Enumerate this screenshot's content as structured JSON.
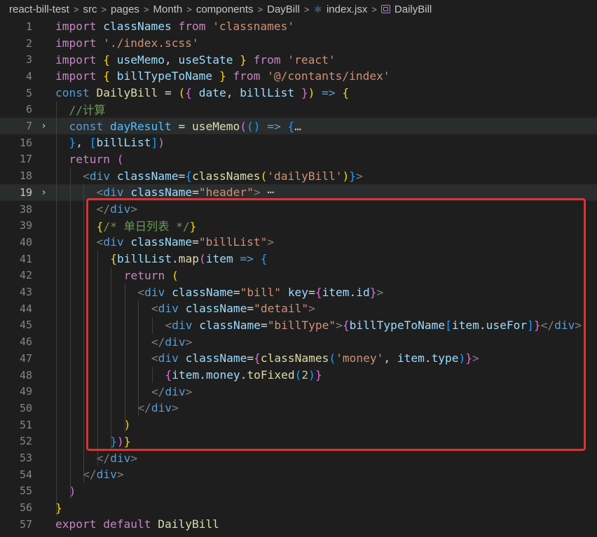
{
  "breadcrumb": {
    "items": [
      "react-bill-test",
      "src",
      "pages",
      "Month",
      "components",
      "DayBill",
      "index.jsx",
      "DailyBill"
    ],
    "separator": ">",
    "icons": {
      "index.jsx": "react-icon",
      "DailyBill": "component-icon"
    }
  },
  "editor": {
    "active_line": "19",
    "lines": [
      {
        "n": "1",
        "tokens": [
          [
            "imp",
            "import"
          ],
          [
            "pun",
            " "
          ],
          [
            "var",
            "classNames"
          ],
          [
            "pun",
            " "
          ],
          [
            "imp",
            "from"
          ],
          [
            "pun",
            " "
          ],
          [
            "str",
            "'classnames'"
          ]
        ]
      },
      {
        "n": "2",
        "tokens": [
          [
            "imp",
            "import"
          ],
          [
            "pun",
            " "
          ],
          [
            "str",
            "'./index.scss'"
          ]
        ]
      },
      {
        "n": "3",
        "tokens": [
          [
            "imp",
            "import"
          ],
          [
            "pun",
            " "
          ],
          [
            "b1",
            "{"
          ],
          [
            "pun",
            " "
          ],
          [
            "var",
            "useMemo"
          ],
          [
            "pun",
            ", "
          ],
          [
            "var",
            "useState"
          ],
          [
            "pun",
            " "
          ],
          [
            "b1",
            "}"
          ],
          [
            "pun",
            " "
          ],
          [
            "imp",
            "from"
          ],
          [
            "pun",
            " "
          ],
          [
            "str",
            "'react'"
          ]
        ]
      },
      {
        "n": "4",
        "tokens": [
          [
            "imp",
            "import"
          ],
          [
            "pun",
            " "
          ],
          [
            "b1",
            "{"
          ],
          [
            "pun",
            " "
          ],
          [
            "var",
            "billTypeToName"
          ],
          [
            "pun",
            " "
          ],
          [
            "b1",
            "}"
          ],
          [
            "pun",
            " "
          ],
          [
            "imp",
            "from"
          ],
          [
            "pun",
            " "
          ],
          [
            "str",
            "'@/contants/index'"
          ]
        ]
      },
      {
        "n": "5",
        "tokens": [
          [
            "kw",
            "const"
          ],
          [
            "pun",
            " "
          ],
          [
            "fn",
            "DailyBill"
          ],
          [
            "pun",
            " = "
          ],
          [
            "b1",
            "("
          ],
          [
            "b2",
            "{"
          ],
          [
            "pun",
            " "
          ],
          [
            "var",
            "date"
          ],
          [
            "pun",
            ", "
          ],
          [
            "var",
            "billList"
          ],
          [
            "pun",
            " "
          ],
          [
            "b2",
            "}"
          ],
          [
            "b1",
            ")"
          ],
          [
            "pun",
            " "
          ],
          [
            "kw",
            "=>"
          ],
          [
            "pun",
            " "
          ],
          [
            "b1",
            "{"
          ]
        ]
      },
      {
        "n": "6",
        "tokens": [
          [
            "com",
            "//计算"
          ]
        ]
      },
      {
        "n": "7",
        "fold": "›",
        "highlight": true,
        "tokens": [
          [
            "kw",
            "const"
          ],
          [
            "pun",
            " "
          ],
          [
            "const",
            "dayResult"
          ],
          [
            "pun",
            " = "
          ],
          [
            "fn",
            "useMemo"
          ],
          [
            "b2",
            "("
          ],
          [
            "b3",
            "("
          ],
          [
            "b3",
            ")"
          ],
          [
            "pun",
            " "
          ],
          [
            "kw",
            "=>"
          ],
          [
            "pun",
            " "
          ],
          [
            "b3",
            "{"
          ],
          [
            "ell",
            "…"
          ]
        ]
      },
      {
        "n": "16",
        "tokens": [
          [
            "b3",
            "}"
          ],
          [
            "pun",
            ", "
          ],
          [
            "b3",
            "["
          ],
          [
            "var",
            "billList"
          ],
          [
            "b3",
            "]"
          ],
          [
            "b2",
            ")"
          ]
        ]
      },
      {
        "n": "17",
        "tokens": [
          [
            "imp",
            "return"
          ],
          [
            "pun",
            " "
          ],
          [
            "b2",
            "("
          ]
        ]
      },
      {
        "n": "18",
        "tokens": [
          [
            "gray",
            "<"
          ],
          [
            "tag",
            "div"
          ],
          [
            "pun",
            " "
          ],
          [
            "attr",
            "className"
          ],
          [
            "pun",
            "="
          ],
          [
            "b3",
            "{"
          ],
          [
            "fn",
            "classNames"
          ],
          [
            "b1",
            "("
          ],
          [
            "str",
            "'dailyBill'"
          ],
          [
            "b1",
            ")"
          ],
          [
            "b3",
            "}"
          ],
          [
            "gray",
            ">"
          ]
        ]
      },
      {
        "n": "19",
        "fold": "›",
        "highlight": true,
        "tokens": [
          [
            "gray",
            "<"
          ],
          [
            "tag",
            "div"
          ],
          [
            "pun",
            " "
          ],
          [
            "attr",
            "className"
          ],
          [
            "pun",
            "="
          ],
          [
            "str",
            "\"header\""
          ],
          [
            "gray",
            ">"
          ],
          [
            "ell",
            " ⋯"
          ]
        ]
      },
      {
        "n": "38",
        "tokens": [
          [
            "gray",
            "</"
          ],
          [
            "tag",
            "div"
          ],
          [
            "gray",
            ">"
          ]
        ]
      },
      {
        "n": "39",
        "tokens": [
          [
            "b1",
            "{"
          ],
          [
            "com",
            "/* 单日列表 */"
          ],
          [
            "b1",
            "}"
          ]
        ]
      },
      {
        "n": "40",
        "tokens": [
          [
            "gray",
            "<"
          ],
          [
            "tag",
            "div"
          ],
          [
            "pun",
            " "
          ],
          [
            "attr",
            "className"
          ],
          [
            "pun",
            "="
          ],
          [
            "str",
            "\"billList\""
          ],
          [
            "gray",
            ">"
          ]
        ]
      },
      {
        "n": "41",
        "tokens": [
          [
            "b1",
            "{"
          ],
          [
            "var",
            "billList"
          ],
          [
            "pun",
            "."
          ],
          [
            "fn",
            "map"
          ],
          [
            "b2",
            "("
          ],
          [
            "var",
            "item"
          ],
          [
            "pun",
            " "
          ],
          [
            "kw",
            "=>"
          ],
          [
            "pun",
            " "
          ],
          [
            "b3",
            "{"
          ]
        ]
      },
      {
        "n": "42",
        "tokens": [
          [
            "imp",
            "return"
          ],
          [
            "pun",
            " "
          ],
          [
            "b1",
            "("
          ]
        ]
      },
      {
        "n": "43",
        "tokens": [
          [
            "gray",
            "<"
          ],
          [
            "tag",
            "div"
          ],
          [
            "pun",
            " "
          ],
          [
            "attr",
            "className"
          ],
          [
            "pun",
            "="
          ],
          [
            "str",
            "\"bill\""
          ],
          [
            "pun",
            " "
          ],
          [
            "attr",
            "key"
          ],
          [
            "pun",
            "="
          ],
          [
            "b2",
            "{"
          ],
          [
            "var",
            "item"
          ],
          [
            "pun",
            "."
          ],
          [
            "var",
            "id"
          ],
          [
            "b2",
            "}"
          ],
          [
            "gray",
            ">"
          ]
        ]
      },
      {
        "n": "44",
        "tokens": [
          [
            "gray",
            "<"
          ],
          [
            "tag",
            "div"
          ],
          [
            "pun",
            " "
          ],
          [
            "attr",
            "className"
          ],
          [
            "pun",
            "="
          ],
          [
            "str",
            "\"detail\""
          ],
          [
            "gray",
            ">"
          ]
        ]
      },
      {
        "n": "45",
        "tokens": [
          [
            "gray",
            "<"
          ],
          [
            "tag",
            "div"
          ],
          [
            "pun",
            " "
          ],
          [
            "attr",
            "className"
          ],
          [
            "pun",
            "="
          ],
          [
            "str",
            "\"billType\""
          ],
          [
            "gray",
            ">"
          ],
          [
            "b2",
            "{"
          ],
          [
            "var",
            "billTypeToName"
          ],
          [
            "b3",
            "["
          ],
          [
            "var",
            "item"
          ],
          [
            "pun",
            "."
          ],
          [
            "var",
            "useFor"
          ],
          [
            "b3",
            "]"
          ],
          [
            "b2",
            "}"
          ],
          [
            "gray",
            "</"
          ],
          [
            "tag",
            "div"
          ],
          [
            "gray",
            ">"
          ]
        ]
      },
      {
        "n": "46",
        "tokens": [
          [
            "gray",
            "</"
          ],
          [
            "tag",
            "div"
          ],
          [
            "gray",
            ">"
          ]
        ]
      },
      {
        "n": "47",
        "tokens": [
          [
            "gray",
            "<"
          ],
          [
            "tag",
            "div"
          ],
          [
            "pun",
            " "
          ],
          [
            "attr",
            "className"
          ],
          [
            "pun",
            "="
          ],
          [
            "b2",
            "{"
          ],
          [
            "fn",
            "classNames"
          ],
          [
            "b3",
            "("
          ],
          [
            "str",
            "'money'"
          ],
          [
            "pun",
            ", "
          ],
          [
            "var",
            "item"
          ],
          [
            "pun",
            "."
          ],
          [
            "var",
            "type"
          ],
          [
            "b3",
            ")"
          ],
          [
            "b2",
            "}"
          ],
          [
            "gray",
            ">"
          ]
        ]
      },
      {
        "n": "48",
        "tokens": [
          [
            "b2",
            "{"
          ],
          [
            "var",
            "item"
          ],
          [
            "pun",
            "."
          ],
          [
            "var",
            "money"
          ],
          [
            "pun",
            "."
          ],
          [
            "fn",
            "toFixed"
          ],
          [
            "b3",
            "("
          ],
          [
            "num",
            "2"
          ],
          [
            "b3",
            ")"
          ],
          [
            "b2",
            "}"
          ]
        ]
      },
      {
        "n": "49",
        "tokens": [
          [
            "gray",
            "</"
          ],
          [
            "tag",
            "div"
          ],
          [
            "gray",
            ">"
          ]
        ]
      },
      {
        "n": "50",
        "tokens": [
          [
            "gray",
            "</"
          ],
          [
            "tag",
            "div"
          ],
          [
            "gray",
            ">"
          ]
        ]
      },
      {
        "n": "51",
        "tokens": [
          [
            "b1",
            ")"
          ]
        ]
      },
      {
        "n": "52",
        "tokens": [
          [
            "b3",
            "}"
          ],
          [
            "b2",
            ")"
          ],
          [
            "b1",
            "}"
          ]
        ]
      },
      {
        "n": "53",
        "tokens": [
          [
            "gray",
            "</"
          ],
          [
            "tag",
            "div"
          ],
          [
            "gray",
            ">"
          ]
        ]
      },
      {
        "n": "54",
        "tokens": [
          [
            "gray",
            "</"
          ],
          [
            "tag",
            "div"
          ],
          [
            "gray",
            ">"
          ]
        ]
      },
      {
        "n": "55",
        "tokens": [
          [
            "b2",
            ")"
          ]
        ]
      },
      {
        "n": "56",
        "tokens": [
          [
            "b1",
            "}"
          ]
        ]
      },
      {
        "n": "57",
        "tokens": [
          [
            "imp",
            "export"
          ],
          [
            "pun",
            " "
          ],
          [
            "imp",
            "default"
          ],
          [
            "pun",
            " "
          ],
          [
            "fn",
            "DailyBill"
          ]
        ]
      }
    ]
  }
}
